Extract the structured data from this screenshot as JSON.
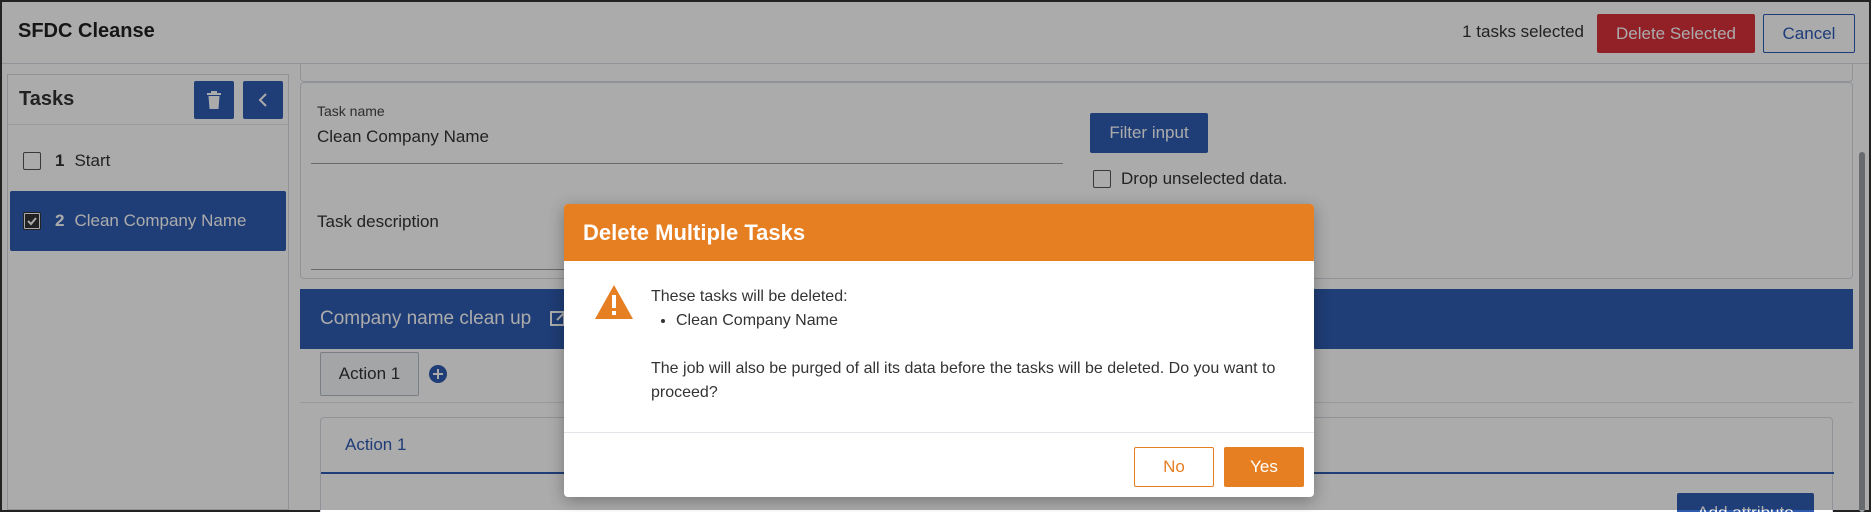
{
  "header": {
    "app_title": "SFDC Cleanse",
    "selected_count": "1 tasks selected",
    "delete_selected_label": "Delete Selected",
    "cancel_label": "Cancel"
  },
  "sidebar": {
    "title": "Tasks",
    "icons": {
      "trash": "trash-icon",
      "collapse": "chevron-left-icon"
    },
    "tasks": [
      {
        "number": "1",
        "name": "Start",
        "checked": false
      },
      {
        "number": "2",
        "name": "Clean Company Name",
        "checked": true
      }
    ]
  },
  "main": {
    "task_name_label": "Task name",
    "task_name_value": "Clean Company Name",
    "task_description_label": "Task description",
    "filter_input_label": "Filter input",
    "drop_unselected_label": "Drop unselected data.",
    "section_title": "Company name clean up",
    "action_tab_label": "Action 1",
    "action_card_title": "Action 1",
    "add_attribute_label": "Add attribute"
  },
  "modal": {
    "title": "Delete Multiple Tasks",
    "intro": "These tasks will be deleted:",
    "tasks": [
      "Clean Company Name"
    ],
    "message": "The job will also be purged of all its data before the tasks will be deleted. Do you want to proceed?",
    "no_label": "No",
    "yes_label": "Yes"
  },
  "colors": {
    "primary": "#2f5bb1",
    "danger": "#d9303b",
    "warning": "#e67e22"
  }
}
